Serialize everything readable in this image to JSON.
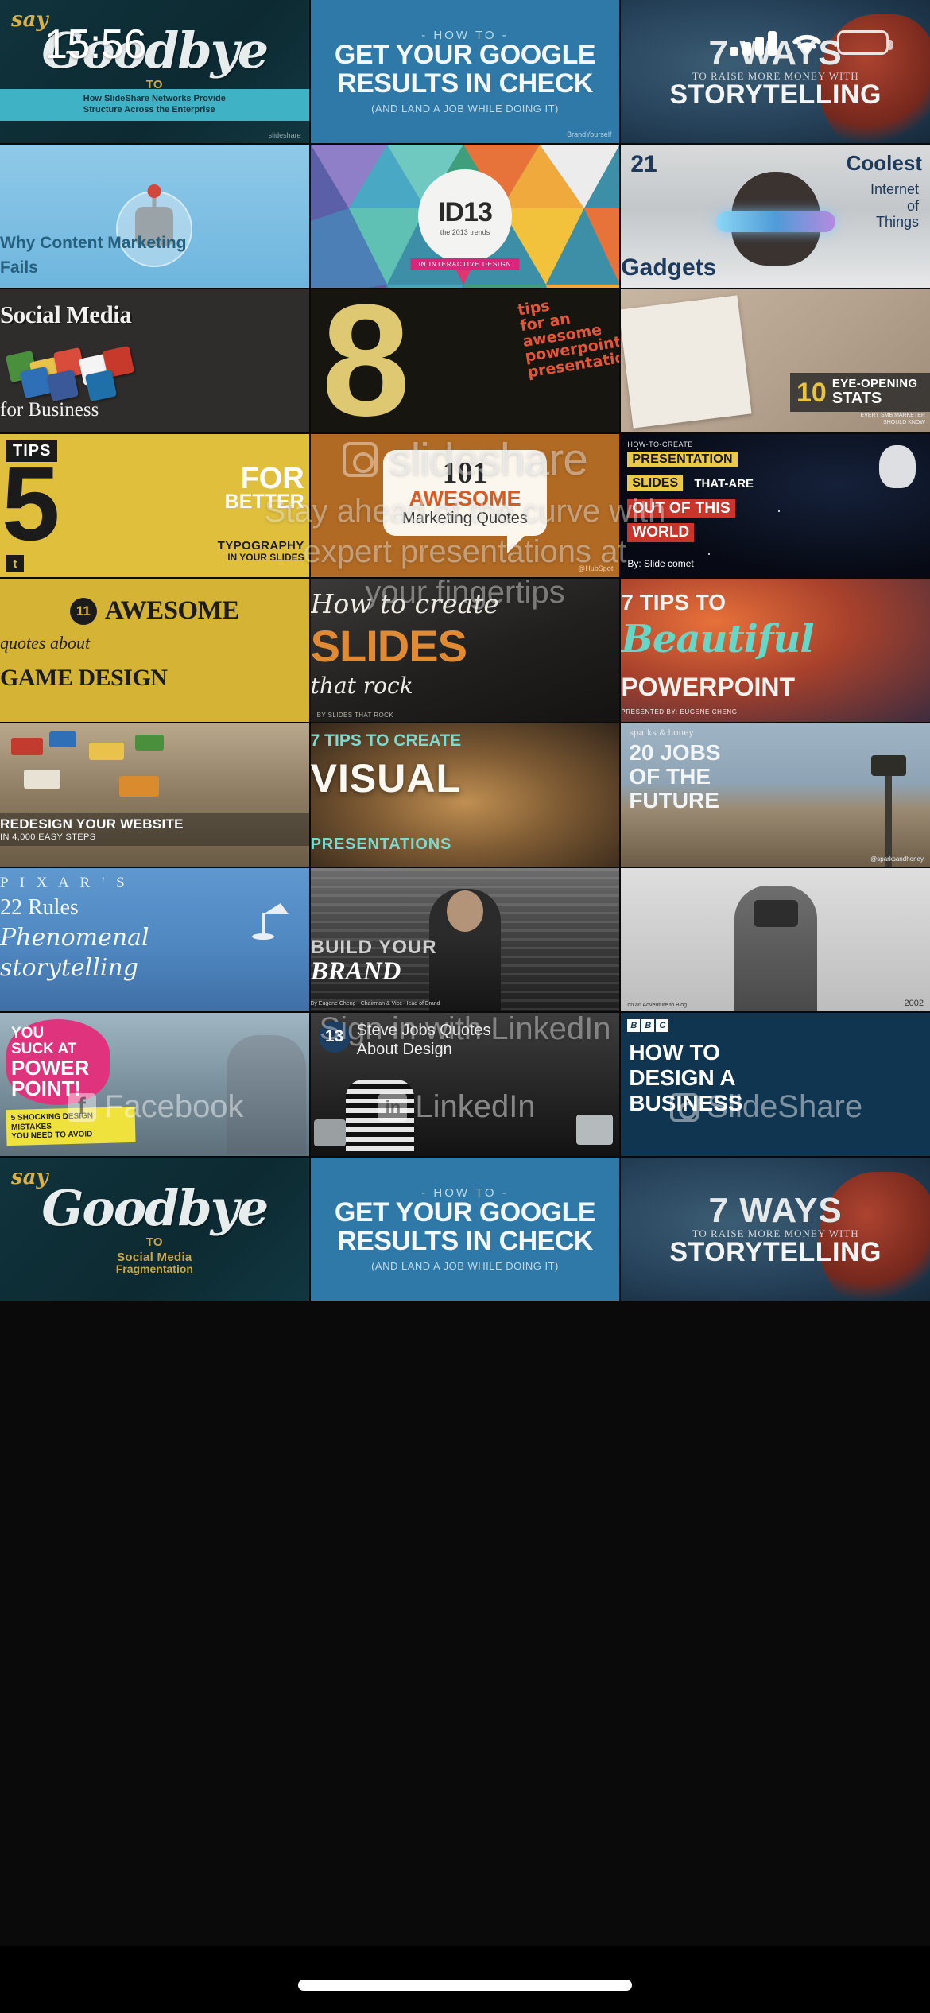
{
  "status_bar": {
    "time": "15:56",
    "signal_icon": "cellular-signal-icon",
    "wifi_icon": "wifi-icon",
    "battery_icon": "battery-icon",
    "battery_color": "#ffd426"
  },
  "watermarks": {
    "brand": "slideshare",
    "tagline_line1": "Stay ahead of the curve with",
    "tagline_line2": "expert presentations at",
    "tagline_line3": "your fingertips",
    "signin": "Sign in with LinkedIn",
    "social": [
      {
        "label": "Facebook",
        "icon": "facebook-icon"
      },
      {
        "label": "LinkedIn",
        "icon": "linkedin-icon"
      },
      {
        "label": "SlideShare",
        "icon": "slideshare-icon"
      }
    ]
  },
  "grid": {
    "columns": 3,
    "tiles": [
      {
        "id": "say-goodbye",
        "theme": "t-goodbye",
        "say": "say",
        "title": "Goodbye",
        "sub": "TO",
        "sub2": "Social Media",
        "sub3": "Fragmentation",
        "bar_line1": "How SlideShare Networks Provide",
        "bar_line2": "Structure Across the Enterprise",
        "logo": "slideshare"
      },
      {
        "id": "google-results",
        "theme": "t-google",
        "kicker": "- HOW TO -",
        "line1": "GET YOUR GOOGLE",
        "line2": "RESULTS IN CHECK",
        "small": "(AND LAND A JOB WHILE DOING IT)",
        "brand": "BrandYourself"
      },
      {
        "id": "7-ways-storytelling",
        "theme": "t-story",
        "line1": "7 WAYS",
        "line2": "TO RAISE MORE MONEY WITH",
        "line3": "STORYTELLING"
      },
      {
        "id": "why-content-marketing-fails",
        "theme": "t-content",
        "line1": "Why Content Marketing",
        "line2": "Fails"
      },
      {
        "id": "id13",
        "theme": "t-id13",
        "disc_title": "ID13",
        "disc_sub": "the 2013 trends",
        "tag": "IN INTERACTIVE DESIGN"
      },
      {
        "id": "21-coolest-iot-gadgets",
        "theme": "t-iot",
        "num": "21",
        "coolest": "Coolest",
        "r1": "Internet",
        "r2": "of",
        "r3": "Things",
        "gadgets": "Gadgets"
      },
      {
        "id": "social-media-for-business",
        "theme": "t-smb",
        "line1": "Social Media",
        "line2": "for Business"
      },
      {
        "id": "8-tips-powerpoint",
        "theme": "t-eight",
        "big": "8",
        "tips_line1": "tips",
        "tips_line2": "for an",
        "tips_line3": "awesome",
        "tips_line4": "powerpoint",
        "tips_line5": "presentation"
      },
      {
        "id": "10-eye-opening-stats",
        "theme": "t-stats",
        "num": "10",
        "t1": "EYE-OPENING",
        "t2": "STATS",
        "sub1": "EVERY SMB MARKETER",
        "sub2": "SHOULD KNOW"
      },
      {
        "id": "5-tips-typography",
        "theme": "t-5tips",
        "tips": "TIPS",
        "five": "5",
        "for": "FOR",
        "better": "BETTER",
        "b1": "TYPOGRAPHY",
        "b2": "IN YOUR SLIDES",
        "tw": "t"
      },
      {
        "id": "101-awesome-marketing-quotes",
        "theme": "t-101",
        "n": "101",
        "awesome": "AWESOME",
        "marketing": "Marketing Quotes",
        "credit": "@HubSpot"
      },
      {
        "id": "out-of-this-world-slides",
        "theme": "t-space",
        "howto": "HOW-TO-CREATE",
        "y1": "PRESENTATION",
        "y2": "SLIDES",
        "w2": "THAT-ARE",
        "r1": "OUT OF THIS",
        "r2": "WORLD",
        "by": "By: Slide comet"
      },
      {
        "id": "11-quotes-game-design",
        "theme": "t-game",
        "n": "11",
        "awesome": "AWESOME",
        "quotes": "quotes about",
        "gd": "GAME DESIGN"
      },
      {
        "id": "how-to-create-slides-that-rock",
        "theme": "t-slides",
        "a": "How to create",
        "b": "SLIDES",
        "c": "that rock",
        "d": "BY SLIDES THAT ROCK"
      },
      {
        "id": "7-tips-beautiful-powerpoint",
        "theme": "t-bpp",
        "a": "7 TIPS TO",
        "b": "Beautiful",
        "c": "POWERPOINT",
        "d": "PRESENTED BY: EUGENE CHENG"
      },
      {
        "id": "redesign-your-website",
        "theme": "t-redesign",
        "a": "REDESIGN YOUR WEBSITE",
        "b": "IN 4,000 EASY STEPS"
      },
      {
        "id": "7-tips-visual-presentations",
        "theme": "t-visual",
        "a": "7 TIPS TO CREATE",
        "b": "VISUAL",
        "c": "PRESENTATIONS"
      },
      {
        "id": "20-jobs-of-the-future",
        "theme": "t-jobs",
        "a": "sparks & honey",
        "b": "20 JOBS\nOF THE\nFUTURE",
        "c": "@sparksandhoney"
      },
      {
        "id": "pixar-22-rules",
        "theme": "t-pixar",
        "a": "P I X A R ' S",
        "b": "22 Rules",
        "c": "Phenomenal",
        "d": "storytelling"
      },
      {
        "id": "build-your-brand-apple",
        "theme": "t-brand",
        "a": "BUILD YOUR",
        "b": "BRAND",
        "c": "By Eugene Cheng · Chairman & Vice-Head of Brand"
      },
      {
        "id": "photography-2002",
        "theme": "t-photo",
        "a": "on an Adventure to Blog",
        "b": "2002"
      },
      {
        "id": "you-suck-at-powerpoint",
        "theme": "t-ppt",
        "a": "YOU",
        "b": "SUCK AT",
        "c": "POWER",
        "d": "POINT!",
        "note1": "5 SHOCKING DESIGN MISTAKES",
        "note2": "YOU NEED TO AVOID"
      },
      {
        "id": "13-steve-jobs-quotes",
        "theme": "t-sj",
        "n": "13",
        "a": "Steve Jobs Quotes",
        "b": "About Design"
      },
      {
        "id": "how-to-design-a-business",
        "theme": "t-hdb",
        "bbc": [
          "B",
          "B",
          "C"
        ],
        "a": "HOW TO",
        "b": "DESIGN A",
        "c": "BUSINESS"
      }
    ],
    "row_repeat": [
      {
        "id": "say-goodbye-2",
        "theme": "t-goodbye",
        "say": "say",
        "title": "Goodbye",
        "sub": "TO",
        "sub2": "Social Media",
        "sub3": "Fragmentation",
        "bar_line1": "How SlideShare Networks Provide",
        "bar_line2": "Structure Across the Enterprise",
        "logo": "slideshare"
      },
      {
        "id": "google-results-2",
        "theme": "t-google",
        "kicker": "- HOW TO -",
        "line1": "GET YOUR GOOGLE",
        "line2": "RESULTS IN CHECK",
        "small": "(AND LAND A JOB WHILE DOING IT)",
        "brand": "BrandYourself"
      },
      {
        "id": "7-ways-storytelling-2",
        "theme": "t-story",
        "line1": "7 WAYS",
        "line2": "TO RAISE MORE MONEY WITH",
        "line3": "STORYTELLING"
      }
    ]
  }
}
